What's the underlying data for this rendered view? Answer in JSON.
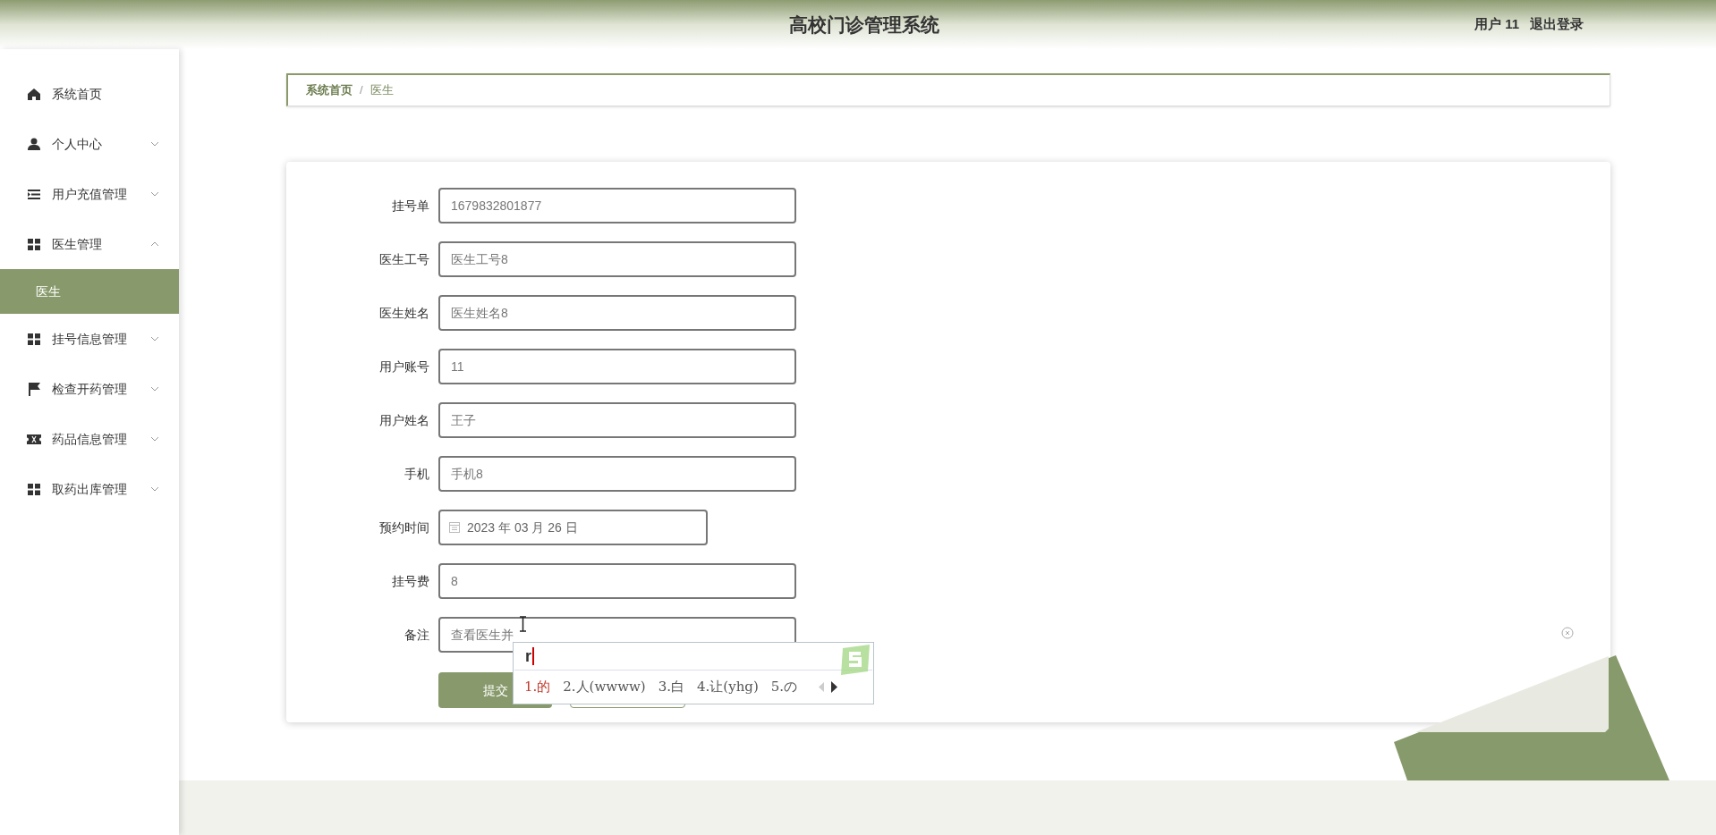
{
  "header": {
    "title": "高校门诊管理系统",
    "user": "用户 11",
    "logout": "退出登录"
  },
  "sidebar": {
    "items": [
      {
        "label": "系统首页",
        "kind": "link"
      },
      {
        "label": "个人中心",
        "kind": "menu",
        "expanded": false
      },
      {
        "label": "用户充值管理",
        "kind": "menu",
        "expanded": false
      },
      {
        "label": "医生管理",
        "kind": "menu",
        "expanded": true,
        "children": [
          {
            "label": "医生",
            "selected": true
          }
        ]
      },
      {
        "label": "挂号信息管理",
        "kind": "menu",
        "expanded": false
      },
      {
        "label": "检查开药管理",
        "kind": "menu",
        "expanded": false
      },
      {
        "label": "药品信息管理",
        "kind": "menu",
        "expanded": false
      },
      {
        "label": "取药出库管理",
        "kind": "menu",
        "expanded": false
      }
    ]
  },
  "breadcrumb": {
    "separator": "/",
    "links": [
      "系统首页",
      "医生"
    ]
  },
  "form": {
    "fields": [
      {
        "label": "挂号单",
        "kind": "text",
        "value": "1679832801877"
      },
      {
        "label": "医生工号",
        "kind": "text",
        "value": "医生工号8"
      },
      {
        "label": "医生姓名",
        "kind": "text",
        "value": "医生姓名8"
      },
      {
        "label": "用户账号",
        "kind": "text",
        "value": "11"
      },
      {
        "label": "用户姓名",
        "kind": "text",
        "value": "王子"
      },
      {
        "label": "手机",
        "kind": "text",
        "value": "手机8"
      },
      {
        "label": "预约时间",
        "kind": "date",
        "value": "2023 年 03 月 26 日"
      },
      {
        "label": "挂号费",
        "kind": "text",
        "value": "8"
      },
      {
        "label": "备注",
        "kind": "text",
        "value": "查看医生并"
      }
    ],
    "buttons": [
      {
        "kind": "primary",
        "label": "提交"
      },
      {
        "kind": "secondary"
      }
    ]
  },
  "ime": {
    "input": "r",
    "candidates": [
      {
        "label": "1.的",
        "selected": true
      },
      {
        "label": "2.人(wwww)",
        "selected": false
      },
      {
        "label": "3.白",
        "selected": false
      },
      {
        "label": "4.让(yhg)",
        "selected": false
      },
      {
        "label": "5.の",
        "selected": false
      }
    ]
  }
}
